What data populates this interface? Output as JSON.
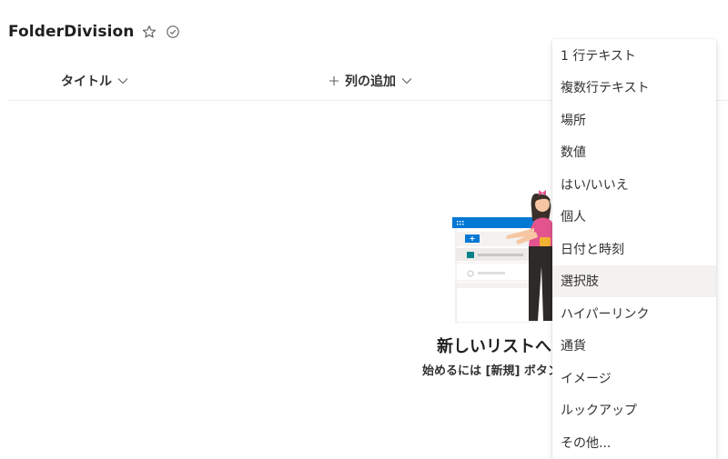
{
  "list": {
    "title": "FolderDivision",
    "favorite_icon": "star-icon",
    "sync_icon": "check-circle-icon"
  },
  "columns": {
    "title_label": "タイトル",
    "add_column_label": "列の追加"
  },
  "empty_state": {
    "heading": "新しいリストへようこそ",
    "subtext": "始めるには [新規] ボタンを選択してください"
  },
  "menu": {
    "items": [
      {
        "label": "1 行テキスト"
      },
      {
        "label": "複数行テキスト"
      },
      {
        "label": "場所"
      },
      {
        "label": "数値"
      },
      {
        "label": "はい/いいえ"
      },
      {
        "label": "個人"
      },
      {
        "label": "日付と時刻"
      },
      {
        "label": "選択肢",
        "selected": true
      },
      {
        "label": "ハイパーリンク"
      },
      {
        "label": "通貨"
      },
      {
        "label": "イメージ"
      },
      {
        "label": "ルックアップ"
      },
      {
        "label": "その他..."
      }
    ]
  },
  "colors": {
    "brand_blue": "#0078d4",
    "teal": "#038387",
    "person_shirt": "#e3548e",
    "selected_bg": "#f3f2f1"
  }
}
